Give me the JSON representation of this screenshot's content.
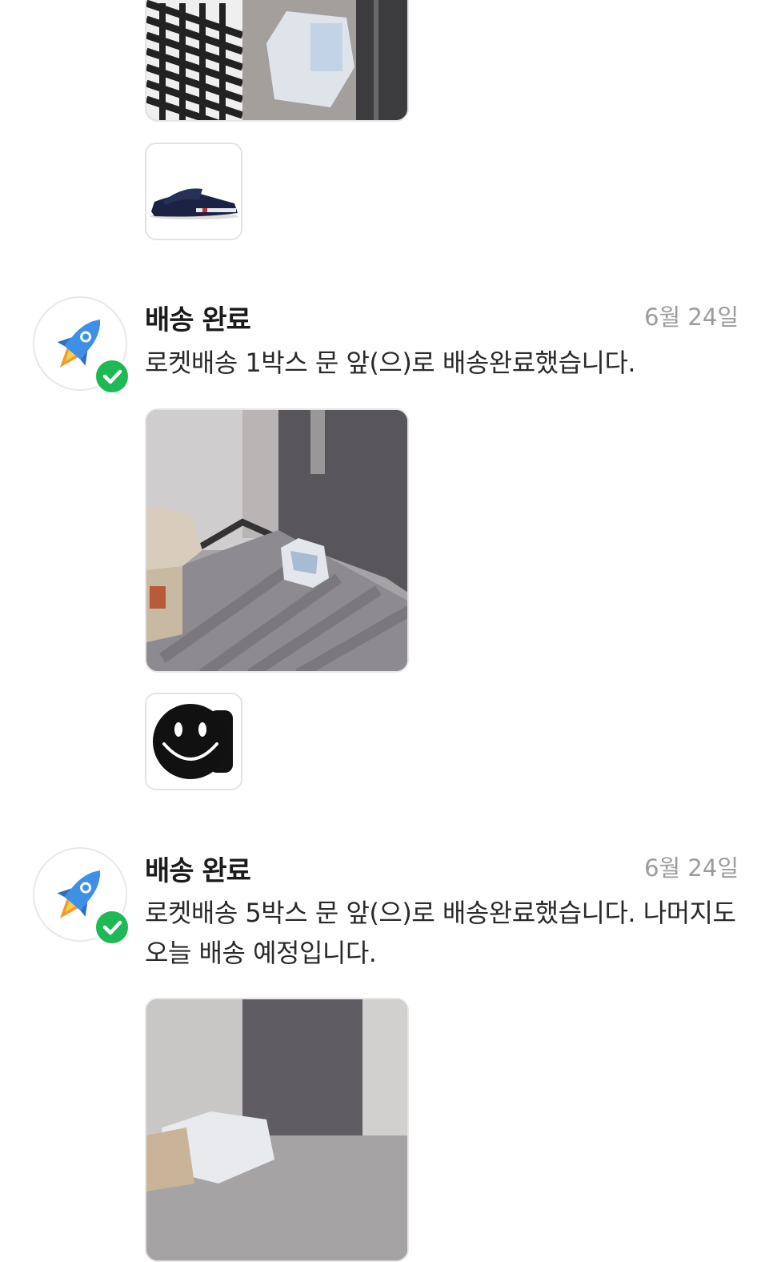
{
  "updates": [
    {
      "title": "배송 완료",
      "date": "6월 24일",
      "message": "로켓배송 1박스 문 앞(으)로 배송완료했습니다.",
      "status_icon": "rocket-icon",
      "photo": "delivery-photo",
      "thumbnail": "smiley-product"
    },
    {
      "title": "배송 완료",
      "date": "6월 24일",
      "message": "로켓배송 5박스 문 앞(으)로 배송완료했습니다. 나머지도 오늘 배송 예정입니다.",
      "status_icon": "rocket-icon",
      "photo": "delivery-photo",
      "thumbnail": null
    }
  ],
  "top_partial": {
    "photo": "delivery-photo",
    "thumbnail": "slipper-product"
  },
  "colors": {
    "check_green": "#1db954",
    "date_gray": "#9c9c9c",
    "title_dark": "#1b1b1b"
  }
}
